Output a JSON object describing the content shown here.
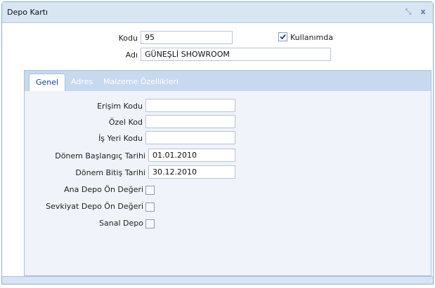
{
  "window": {
    "title": "Depo Kartı",
    "restore_glyph": "⤡",
    "close_glyph": "x"
  },
  "header": {
    "kodu_label": "Kodu",
    "kodu_value": "95",
    "kullanimda_label": "Kullanımda",
    "kullanimda_checked": true,
    "adi_label": "Adı",
    "adi_value": "GÜNEŞLİ SHOWROOM"
  },
  "tabs": [
    {
      "label": "Genel",
      "active": true
    },
    {
      "label": "Adres",
      "active": false
    },
    {
      "label": "Malzeme Özellikleri",
      "active": false
    }
  ],
  "genel": {
    "erisim_kodu_label": "Erişim Kodu",
    "erisim_kodu_value": "",
    "ozel_kod_label": "Özel Kod",
    "ozel_kod_value": "",
    "is_yeri_kodu_label": "İş Yeri Kodu",
    "is_yeri_kodu_value": "",
    "donem_baslangic_label": "Dönem Başlangıç Tarihi",
    "donem_baslangic_value": "01.01.2010",
    "donem_bitis_label": "Dönem Bitiş Tarihi",
    "donem_bitis_value": "30.12.2010",
    "ana_depo_label": "Ana Depo Ön Değeri",
    "ana_depo_checked": false,
    "sevkiyat_depo_label": "Sevkiyat Depo Ön Değeri",
    "sevkiyat_depo_checked": false,
    "sanal_depo_label": "Sanal Depo",
    "sanal_depo_checked": false
  },
  "colors": {
    "titlebar_bg": "#d8e5f3",
    "tabstrip_bg": "#c6d9ef",
    "active_tab_text": "#15428b",
    "panel_bg": "#f0f3f9"
  }
}
